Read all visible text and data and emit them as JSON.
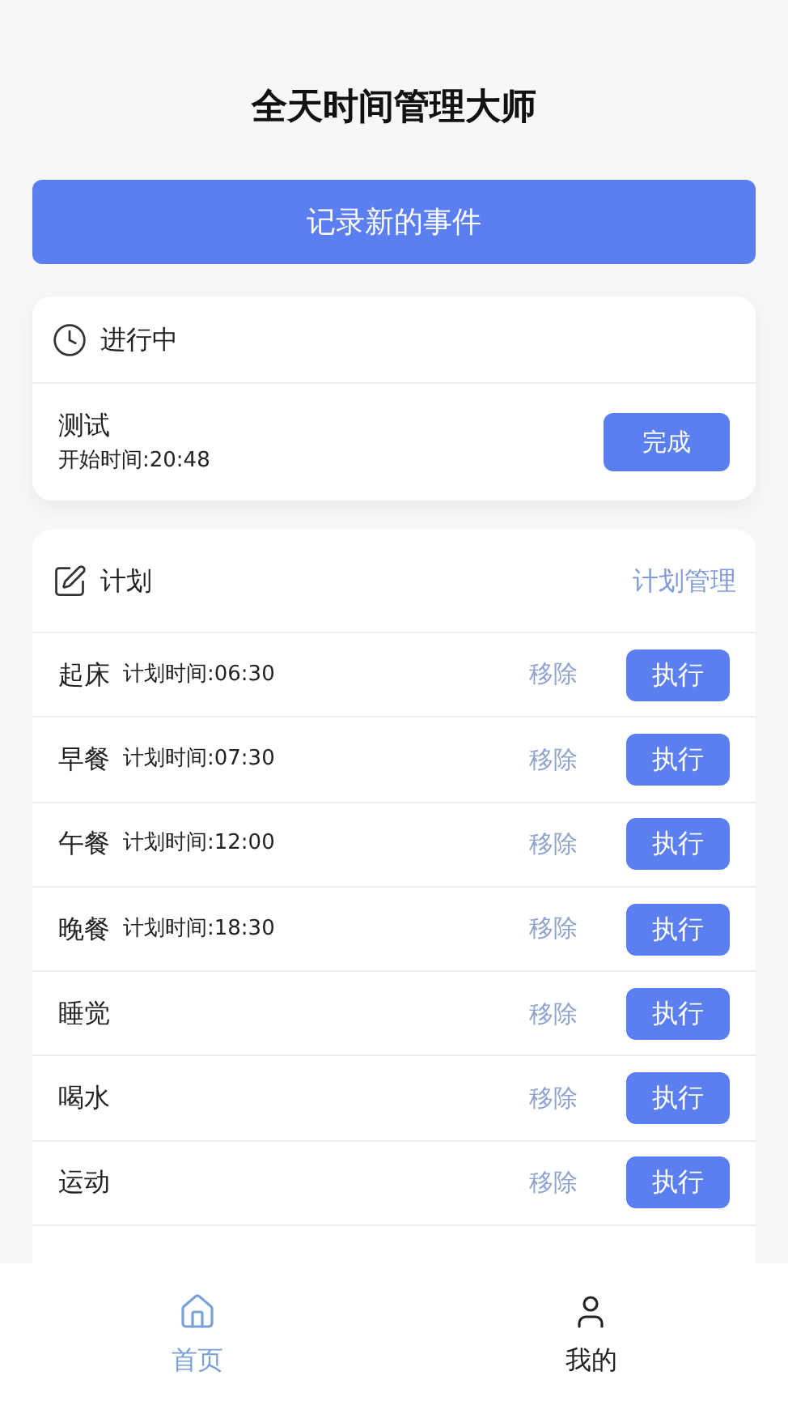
{
  "title": "全天时间管理大师",
  "record_button": "记录新的事件",
  "in_progress": {
    "heading": "进行中",
    "name": "测试",
    "start_time": "开始时间:20:48",
    "done_button": "完成"
  },
  "plan": {
    "heading": "计划",
    "manage_link": "计划管理",
    "items": [
      {
        "name": "起床",
        "time": "计划时间:06:30",
        "remove": "移除",
        "execute": "执行"
      },
      {
        "name": "早餐",
        "time": "计划时间:07:30",
        "remove": "移除",
        "execute": "执行"
      },
      {
        "name": "午餐",
        "time": "计划时间:12:00",
        "remove": "移除",
        "execute": "执行"
      },
      {
        "name": "晚餐",
        "time": "计划时间:18:30",
        "remove": "移除",
        "execute": "执行"
      },
      {
        "name": "睡觉",
        "remove": "移除",
        "execute": "执行"
      },
      {
        "name": "喝水",
        "remove": "移除",
        "execute": "执行"
      },
      {
        "name": "运动",
        "remove": "移除",
        "execute": "执行"
      }
    ]
  },
  "tabs": [
    {
      "label": "首页",
      "selected": true
    },
    {
      "label": "我的",
      "selected": false
    }
  ]
}
